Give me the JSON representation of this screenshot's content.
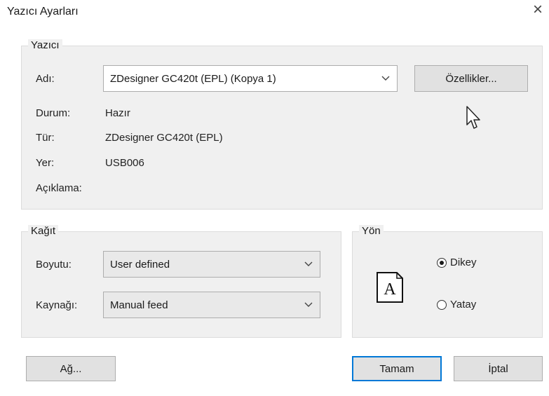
{
  "window": {
    "title": "Yazıcı Ayarları",
    "close_glyph": "×"
  },
  "printer_group": {
    "label": "Yazıcı",
    "name_label": "Adı:",
    "name_value": "ZDesigner GC420t (EPL) (Kopya 1)",
    "properties_button": "Özellikler...",
    "status_label": "Durum:",
    "status_value": "Hazır",
    "type_label": "Tür:",
    "type_value": "ZDesigner GC420t (EPL)",
    "location_label": "Yer:",
    "location_value": "USB006",
    "comment_label": "Açıklama:"
  },
  "paper_group": {
    "label": "Kağıt",
    "size_label": "Boyutu:",
    "size_value": "User defined",
    "source_label": "Kaynağı:",
    "source_value": "Manual feed"
  },
  "orientation_group": {
    "label": "Yön",
    "icon_letter": "A",
    "options": [
      {
        "label": "Dikey",
        "selected": true
      },
      {
        "label": "Yatay",
        "selected": false
      }
    ]
  },
  "buttons": {
    "network": "Ağ...",
    "ok": "Tamam",
    "cancel": "İptal"
  }
}
